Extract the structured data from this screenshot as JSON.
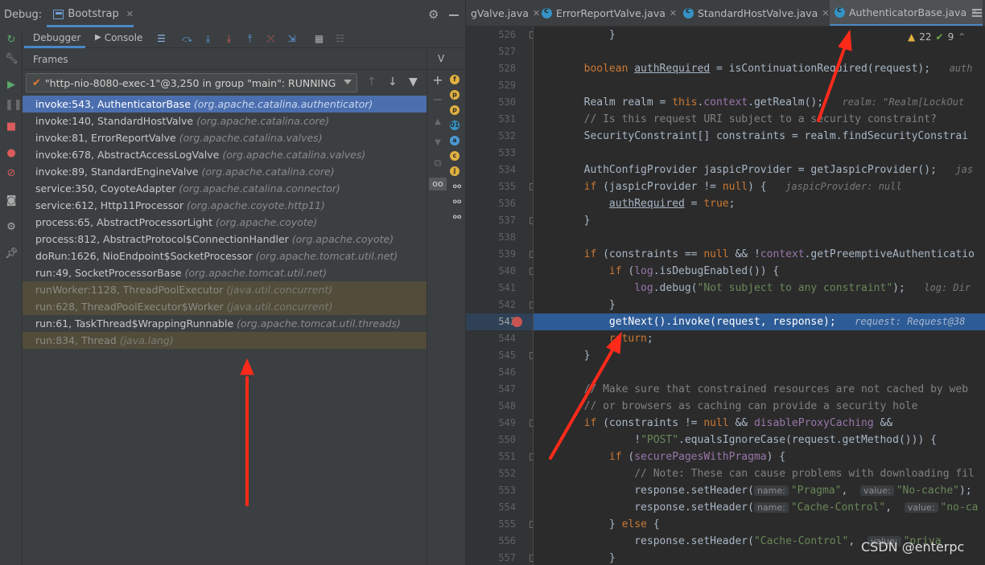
{
  "debug": {
    "label": "Debug:",
    "tab": "Bootstrap",
    "subtabs": {
      "debugger": "Debugger",
      "console": "Console"
    },
    "frames_title": "Frames",
    "vars_title": "V",
    "thread": "\"http-nio-8080-exec-1\"@3,250 in group \"main\": RUNNING",
    "frames": [
      {
        "m": "invoke:543, AuthenticatorBase",
        "p": "(org.apache.catalina.authenticator)"
      },
      {
        "m": "invoke:140, StandardHostValve",
        "p": "(org.apache.catalina.core)"
      },
      {
        "m": "invoke:81, ErrorReportValve",
        "p": "(org.apache.catalina.valves)"
      },
      {
        "m": "invoke:678, AbstractAccessLogValve",
        "p": "(org.apache.catalina.valves)"
      },
      {
        "m": "invoke:89, StandardEngineValve",
        "p": "(org.apache.catalina.core)"
      },
      {
        "m": "service:350, CoyoteAdapter",
        "p": "(org.apache.catalina.connector)"
      },
      {
        "m": "service:612, Http11Processor",
        "p": "(org.apache.coyote.http11)"
      },
      {
        "m": "process:65, AbstractProcessorLight",
        "p": "(org.apache.coyote)"
      },
      {
        "m": "process:812, AbstractProtocol$ConnectionHandler",
        "p": "(org.apache.coyote)"
      },
      {
        "m": "doRun:1626, NioEndpoint$SocketProcessor",
        "p": "(org.apache.tomcat.util.net)"
      },
      {
        "m": "run:49, SocketProcessorBase",
        "p": "(org.apache.tomcat.util.net)"
      },
      {
        "m": "runWorker:1128, ThreadPoolExecutor",
        "p": "(java.util.concurrent)"
      },
      {
        "m": "run:628, ThreadPoolExecutor$Worker",
        "p": "(java.util.concurrent)"
      },
      {
        "m": "run:61, TaskThread$WrappingRunnable",
        "p": "(org.apache.tomcat.util.threads)"
      },
      {
        "m": "run:834, Thread",
        "p": "(java.lang)"
      }
    ],
    "var_letters": [
      "f",
      "p",
      "p",
      "01",
      "a",
      "c",
      "j",
      "oo",
      "oo",
      "oo"
    ]
  },
  "editor": {
    "tabs": [
      "gValve.java",
      "ErrorReportValve.java",
      "StandardHostValve.java",
      "AuthenticatorBase.java"
    ],
    "warnings": "22",
    "checks": "9",
    "lines": [
      "526",
      "527",
      "528",
      "529",
      "530",
      "531",
      "532",
      "533",
      "534",
      "535",
      "536",
      "537",
      "538",
      "539",
      "540",
      "541",
      "542",
      "543",
      "544",
      "545",
      "546",
      "547",
      "548",
      "549",
      "550",
      "551",
      "552",
      "553",
      "554",
      "555",
      "556",
      "557"
    ],
    "code": {
      "l526": "            }",
      "l528a": "        boolean ",
      "l528b": "authRequired",
      "l528c": " = isContinuationRequired(request);   ",
      "l528h": "auth",
      "l530a": "        Realm realm = ",
      "l530k": "this",
      "l530b": ".",
      "l530f": "context",
      "l530c": ".getRealm();   ",
      "l530h": "realm: \"Realm[LockOut",
      "l531": "        // Is this request URI subject to a security constraint?",
      "l532": "        SecurityConstraint[] constraints = realm.findSecurityConstrai",
      "l534a": "        AuthConfigProvider jaspicProvider = getJaspicProvider();   ",
      "l534h": "jas",
      "l535a": "        if",
      "l535b": " (jaspicProvider != ",
      "l535n": "null",
      "l535c": ") {   ",
      "l535h": "jaspicProvider: null",
      "l536a": "            ",
      "l536b": "authRequired",
      "l536c": " = ",
      "l536t": "true",
      "l536d": ";",
      "l537": "        }",
      "l539a": "        if",
      "l539b": " (constraints == ",
      "l539n": "null",
      "l539c": " && !",
      "l539f": "context",
      "l539d": ".getPreemptiveAuthenticatio",
      "l540a": "            if",
      "l540b": " (",
      "l540f": "log",
      "l540c": ".isDebugEnabled()) {",
      "l541a": "                ",
      "l541f": "log",
      "l541b": ".debug(",
      "l541s": "\"Not subject to any constraint\"",
      "l541c": ");   ",
      "l541h": "log: Dir",
      "l542": "            }",
      "l543a": "            getNext().invoke(request, response);   ",
      "l543h": "request: Request@38",
      "l544a": "            ",
      "l544k": "return",
      "l544b": ";",
      "l545": "        }",
      "l547": "        // Make sure that constrained resources are not cached by web",
      "l548": "        // or browsers as caching can provide a security hole",
      "l549a": "        if",
      "l549b": " (constraints != ",
      "l549n": "null",
      "l549c": " && ",
      "l549f": "disableProxyCaching",
      "l549d": " &&",
      "l550a": "                !",
      "l550s": "\"POST\"",
      "l550b": ".equalsIgnoreCase(request.getMethod())) {",
      "l551a": "            if",
      "l551b": " (",
      "l551f": "securePagesWithPragma",
      "l551c": ") {",
      "l552": "                // Note: These can cause problems with downloading fil",
      "l553a": "                response.setHeader(",
      "l553p1": "name:",
      "l553s1": "\"Pragma\"",
      "l553b": ",  ",
      "l553p2": "value:",
      "l553s2": "\"No-cache\"",
      "l553c": ");",
      "l554a": "                response.setHeader(",
      "l554p1": "name:",
      "l554s1": "\"Cache-Control\"",
      "l554b": ",  ",
      "l554p2": "value:",
      "l554s2": "\"no-ca",
      "l555a": "            } ",
      "l555k": "else",
      "l555b": " {",
      "l556a": "                response.setHeader(",
      "l556s1": "\"Cache-Control\"",
      "l556b": ",  ",
      "l556p2": "value:",
      "l556s2": "\"priva",
      "l557": "            }"
    }
  },
  "watermark": "CSDN @enterpc",
  "colors": {
    "accent": "#4a88c7",
    "selection": "#4b6eaf",
    "breakpoint": "#c75450",
    "annotation": "#ff2a1a"
  }
}
